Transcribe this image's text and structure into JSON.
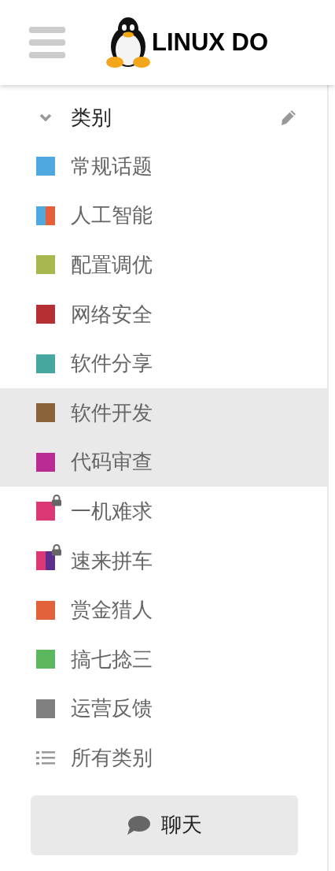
{
  "header": {
    "logo_text": "LINUX DO"
  },
  "categories": {
    "title": "类别",
    "expanded": true,
    "items": [
      {
        "label": "常规话题",
        "colors": [
          {
            "color": "#4fa8e0"
          }
        ],
        "locked": false,
        "selected": false
      },
      {
        "label": "人工智能",
        "colors": [
          {
            "color": "#4fa8e0"
          },
          {
            "color": "#e4603a"
          }
        ],
        "locked": false,
        "selected": false
      },
      {
        "label": "配置调优",
        "colors": [
          {
            "color": "#a8b84f"
          }
        ],
        "locked": false,
        "selected": false
      },
      {
        "label": "网络安全",
        "colors": [
          {
            "color": "#b53034"
          }
        ],
        "locked": false,
        "selected": false
      },
      {
        "label": "软件分享",
        "colors": [
          {
            "color": "#45a79f"
          }
        ],
        "locked": false,
        "selected": false
      },
      {
        "label": "软件开发",
        "colors": [
          {
            "color": "#8b6239"
          }
        ],
        "locked": false,
        "selected": true
      },
      {
        "label": "代码审查",
        "colors": [
          {
            "color": "#bb2b94"
          }
        ],
        "locked": false,
        "selected": true
      },
      {
        "label": "一机难求",
        "colors": [
          {
            "color": "#dc3876"
          }
        ],
        "locked": true,
        "selected": false
      },
      {
        "label": "速来拼车",
        "colors": [
          {
            "color": "#dc3876"
          },
          {
            "color": "#5e2e8e"
          }
        ],
        "locked": true,
        "selected": false
      },
      {
        "label": "赏金猎人",
        "colors": [
          {
            "color": "#e2633b"
          }
        ],
        "locked": false,
        "selected": false
      },
      {
        "label": "搞七捻三",
        "colors": [
          {
            "color": "#5cb85c"
          }
        ],
        "locked": false,
        "selected": false
      },
      {
        "label": "运营反馈",
        "colors": [
          {
            "color": "#808080"
          }
        ],
        "locked": false,
        "selected": false
      }
    ],
    "all_label": "所有类别"
  },
  "chat_button": {
    "label": "聊天"
  }
}
